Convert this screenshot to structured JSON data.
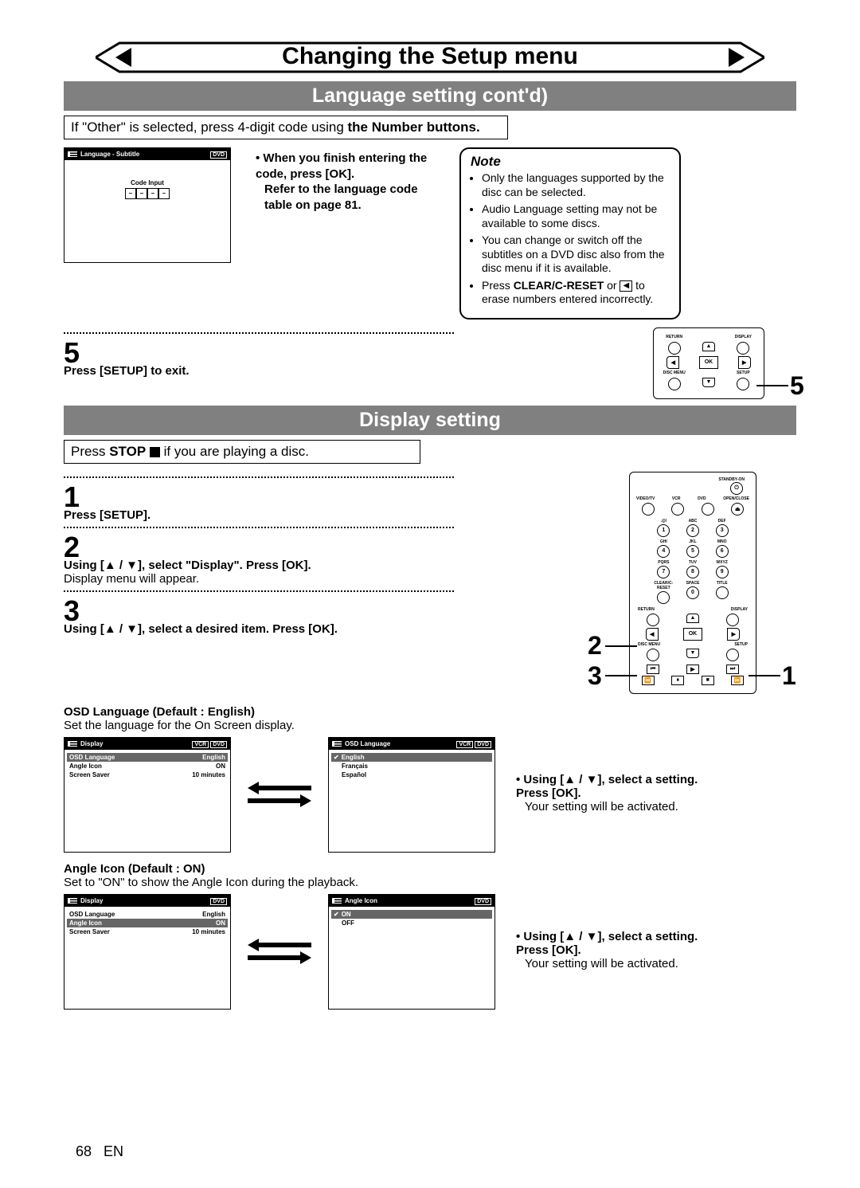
{
  "page": {
    "title": "Changing the Setup menu",
    "subsection1": "Language setting cont'd)",
    "subsection2": "Display setting",
    "page_num": "68",
    "lang": "EN"
  },
  "sec1": {
    "intro_pre": "If \"Other\" is selected, press 4-digit code using ",
    "intro_bold": "the Number buttons.",
    "osd": {
      "title": "Language - Subtitle",
      "badge": "DVD",
      "code_label": "Code Input"
    },
    "instr": {
      "l1": "When you finish entering the code, press [OK].",
      "l2": "Refer to the language code table on page 81."
    },
    "note": {
      "title": "Note",
      "i1": "Only the languages supported by the disc can be selected.",
      "i2": "Audio Language setting may not be available to some discs.",
      "i3": "You can change or switch off the subtitles on a DVD disc also from the disc menu if it is available.",
      "i4a": "Press ",
      "i4b": "CLEAR/C-RESET",
      "i4c": " or ",
      "i4d": " to erase numbers entered incorrectly."
    },
    "step5": {
      "num": "5",
      "text": "Press [SETUP] to exit."
    }
  },
  "sec2": {
    "intro_pre": "Press ",
    "intro_bold": "STOP",
    "intro_post": " if you are playing a disc.",
    "step1": {
      "num": "1",
      "text": "Press [SETUP]."
    },
    "step2": {
      "num": "2",
      "text": "Using [▲ / ▼], select \"Display\". Press [OK].",
      "sub": "Display menu will appear."
    },
    "step3": {
      "num": "3",
      "text": "Using [▲ / ▼], select a desired item. Press [OK]."
    },
    "osdlang": {
      "heading": "OSD Language (Default : English)",
      "desc": "Set the language for the On Screen display.",
      "left": {
        "title": "Display",
        "b1": "VCR",
        "b2": "DVD",
        "r1a": "OSD Language",
        "r1b": "English",
        "r2a": "Angle Icon",
        "r2b": "ON",
        "r3a": "Screen Saver",
        "r3b": "10 minutes"
      },
      "right": {
        "title": "OSD Language",
        "b1": "VCR",
        "b2": "DVD",
        "o1": "English",
        "o2": "Français",
        "o3": "Español"
      },
      "instr": "Using [▲ / ▼], select a setting. Press [OK].",
      "sub": "Your setting will be activated."
    },
    "angle": {
      "heading": "Angle Icon (Default : ON)",
      "desc": "Set to \"ON\" to show the Angle Icon during the playback.",
      "left": {
        "title": "Display",
        "b1": "DVD",
        "r1a": "OSD Language",
        "r1b": "English",
        "r2a": "Angle Icon",
        "r2b": "ON",
        "r3a": "Screen Saver",
        "r3b": "10 minutes"
      },
      "right": {
        "title": "Angle Icon",
        "b1": "DVD",
        "o1": "ON",
        "o2": "OFF"
      },
      "instr": "Using [▲ / ▼], select a setting. Press [OK].",
      "sub": "Your setting will be activated."
    }
  },
  "remote": {
    "return": "RETURN",
    "display": "DISPLAY",
    "ok": "OK",
    "discmenu": "DISC MENU",
    "setup": "SETUP",
    "standby": "STANDBY-ON",
    "video": "VIDEO/TV",
    "vcr": "VCR",
    "dvd": "DVD",
    "open": "OPEN/CLOSE",
    "clear": "CLEAR/C-RESET",
    "space": "SPACE",
    "title": "TITLE",
    "abc": "ABC",
    "def": "DEF",
    "ghi": "GHI",
    "jkl": "JKL",
    "mno": "MNO",
    "pqrs": "PQRS",
    "tuv": "TUV",
    "wxyz": "WXYZ",
    "at": ".@/"
  },
  "nums": {
    "n1": "1",
    "n2": "2",
    "n3": "3",
    "n5": "5"
  }
}
